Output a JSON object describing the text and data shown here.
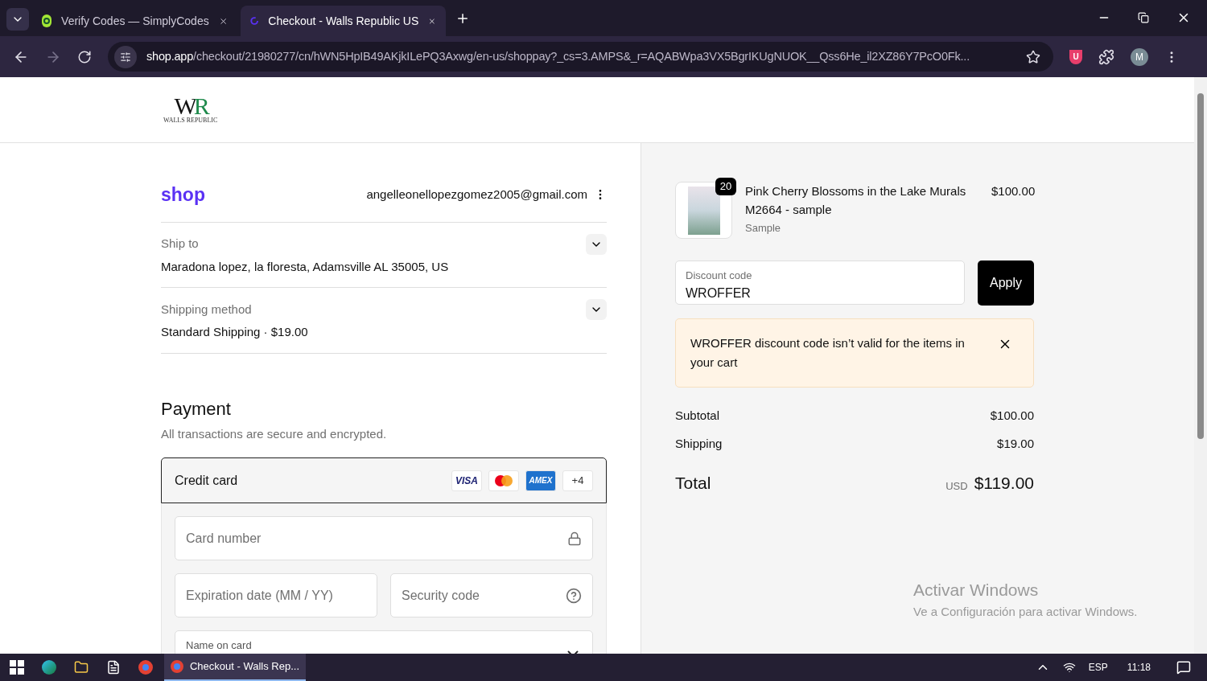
{
  "browser": {
    "tabs": [
      {
        "title": "Verify Codes — SimplyCodes",
        "kind": "simplycodes",
        "selected": false
      },
      {
        "title": "Checkout - Walls Republic US",
        "kind": "shop",
        "selected": true
      }
    ],
    "url_host": "shop.app",
    "url_path": "/checkout/21980277/cn/hWN5HpIB49AKjkILePQ3Axwg/en-us/shoppay?_cs=3.AMPS&_r=AQABWpa3VX5BgrIKUgNUOK__Qss6He_il2XZ86Y7PcO0Fk...",
    "extension_badge": "U",
    "profile_initial": "M"
  },
  "store": {
    "logo_left": "W",
    "logo_right": "R",
    "logo_tagline": "WALLS REPUBLIC"
  },
  "account": {
    "shop_logo": "shop",
    "email": "angelleonellopezgomez2005@gmail.com"
  },
  "sections": [
    {
      "label": "Ship to",
      "value": "Maradona lopez, la floresta, Adamsville AL 35005, US",
      "expanded": false
    },
    {
      "label": "Shipping method",
      "value": "Standard Shipping · $19.00",
      "expanded": false
    }
  ],
  "payment": {
    "title": "Payment",
    "subtitle": "All transactions are secure and encrypted.",
    "method": {
      "label": "Credit card",
      "selected": true,
      "brands": [
        {
          "kind": "visa",
          "label": "VISA"
        },
        {
          "kind": "mastercard"
        },
        {
          "kind": "amex",
          "label": "AMEX"
        },
        {
          "kind": "more",
          "label": "+4"
        }
      ]
    },
    "fields": [
      {
        "kind": "card_number",
        "placeholder": "Card number"
      },
      {
        "kind": "expiry",
        "placeholder": "Expiration date (MM / YY)"
      },
      {
        "kind": "security",
        "placeholder": "Security code"
      },
      {
        "kind": "name",
        "label": "Name on card"
      }
    ]
  },
  "order": {
    "item": {
      "quantity": "20",
      "title": "Pink Cherry Blossoms in the Lake Murals M2664 - sample",
      "variant": "Sample",
      "price": "$100.00"
    },
    "discount": {
      "label": "Discount code",
      "value": "WROFFER",
      "button": "Apply"
    },
    "alert": {
      "message": "WROFFER discount code isn’t valid for the items in your cart"
    },
    "summary": [
      {
        "label": "Subtotal",
        "value": "$100.00"
      },
      {
        "label": "Shipping",
        "value": "$19.00"
      }
    ],
    "total": {
      "label": "Total",
      "currency": "USD",
      "amount": "$119.00"
    }
  },
  "windows_notice": {
    "title": "Activar Windows",
    "body": "Ve a Configuración para activar Windows."
  },
  "taskbar": {
    "active_app": "Checkout - Walls Rep...",
    "language": "ESP",
    "time": "11:18"
  }
}
